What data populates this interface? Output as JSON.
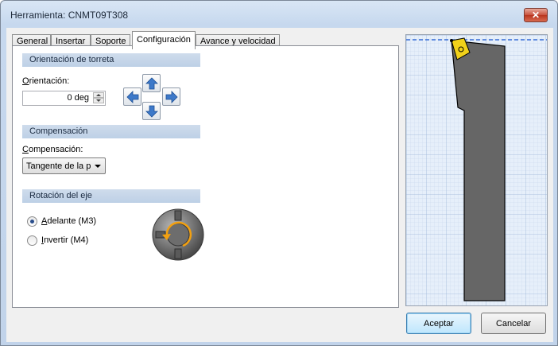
{
  "window": {
    "title": "Herramienta: CNMT09T308",
    "close_label": "✕"
  },
  "tabs": [
    {
      "label": "General"
    },
    {
      "label": "Insertar"
    },
    {
      "label": "Soporte"
    },
    {
      "label": "Configuración"
    },
    {
      "label": "Avance y velocidad"
    }
  ],
  "active_tab": "Configuración",
  "turret": {
    "header": "Orientación de torreta",
    "label_mnemonic": "O",
    "label_rest": "rientación:",
    "value": "0 deg"
  },
  "compensation": {
    "header": "Compensación",
    "label_mnemonic": "C",
    "label_rest": "ompensación:",
    "selected": "Tangente de la p"
  },
  "spindle": {
    "header": "Rotación del eje",
    "options": [
      {
        "mnemonic": "A",
        "rest": "delante (M3)",
        "checked": true
      },
      {
        "mnemonic": "I",
        "rest": "nvertir (M4)",
        "checked": false
      }
    ]
  },
  "buttons": {
    "ok": "Aceptar",
    "cancel": "Cancelar"
  },
  "colors": {
    "insert": "#f2d21a",
    "holder": "#666666",
    "guide_line": "#3a6fd8",
    "rotation_arrow": "#f2a010"
  }
}
